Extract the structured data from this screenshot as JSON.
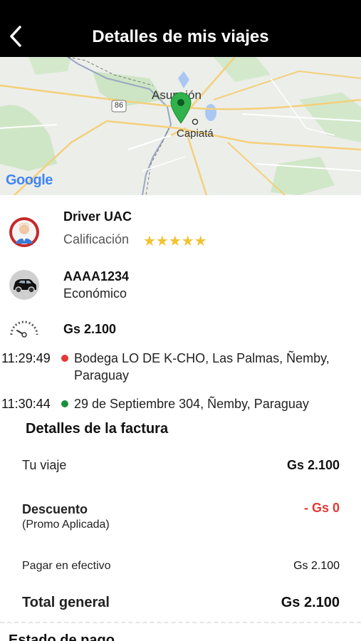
{
  "header": {
    "title": "Detalles de mis viajes",
    "back_icon": "chevron-left-icon"
  },
  "map": {
    "labels": {
      "city_1": "Asunción",
      "city_2": "Capiatá",
      "route": "86",
      "brand": "Google"
    },
    "marker_color": "#2fb24c"
  },
  "driver": {
    "name": "Driver UAC",
    "rating_label": "Calificación",
    "stars": "★★★★★",
    "rating_value": 5
  },
  "vehicle": {
    "plate": "AAAA1234",
    "category": "Económico"
  },
  "fare": {
    "amount": "Gs 2.100"
  },
  "trip": {
    "pickup": {
      "time": "11:29:49",
      "address": "Bodega LO DE K-CHO, Las Palmas, Ñemby, Paraguay",
      "dot_color": "#e53935"
    },
    "dropoff": {
      "time": "11:30:44",
      "address": "29 de Septiembre 304, Ñemby, Paraguay",
      "dot_color": "#1e8e3e"
    }
  },
  "invoice": {
    "title": "Detalles de la factura",
    "trip_label": "Tu viaje",
    "trip_value": "Gs 2.100",
    "discount_label": "Descuento",
    "discount_note": "(Promo Aplicada)",
    "discount_value": "- Gs 0",
    "cash_label": "Pagar en efectivo",
    "cash_value": "Gs 2.100",
    "total_label": "Total general",
    "total_value": "Gs 2.100"
  },
  "payment": {
    "title": "Estado de pago"
  },
  "colors": {
    "header_bg": "#000000",
    "star": "#f2c230",
    "discount_red": "#e53935"
  }
}
